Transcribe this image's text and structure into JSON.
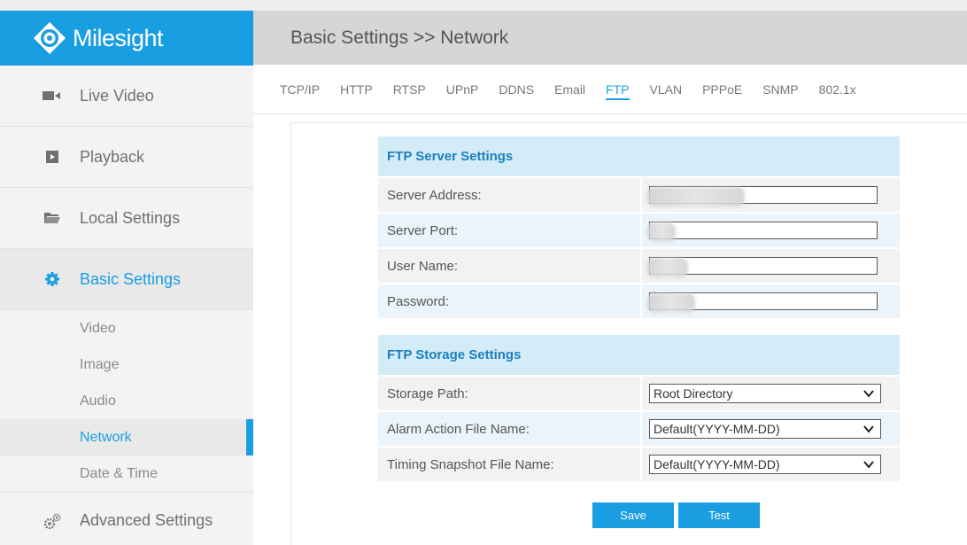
{
  "app": {
    "brand": "Milesight",
    "accent_color": "#1a9ee2"
  },
  "sidebar": {
    "items": [
      {
        "label": "Live Video",
        "icon": "video-camera-icon"
      },
      {
        "label": "Playback",
        "icon": "play-icon"
      },
      {
        "label": "Local Settings",
        "icon": "folder-icon"
      },
      {
        "label": "Basic Settings",
        "icon": "gear-icon"
      }
    ],
    "sub_items": [
      "Video",
      "Image",
      "Audio",
      "Network",
      "Date & Time"
    ],
    "active_sub": "Network",
    "bottom_item": {
      "label": "Advanced Settings",
      "icon": "gears-icon"
    }
  },
  "header": {
    "title": "Basic Settings >> Network"
  },
  "tabs": [
    "TCP/IP",
    "HTTP",
    "RTSP",
    "UPnP",
    "DDNS",
    "Email",
    "FTP",
    "VLAN",
    "PPPoE",
    "SNMP",
    "802.1x"
  ],
  "active_tab": "FTP",
  "ftp_server": {
    "title": "FTP Server Settings",
    "server_address_label": "Server Address:",
    "server_port_label": "Server Port:",
    "user_name_label": "User Name:",
    "password_label": "Password:"
  },
  "ftp_storage": {
    "title": "FTP Storage Settings",
    "storage_path_label": "Storage Path:",
    "storage_path_value": "Root Directory",
    "alarm_file_label": "Alarm Action File Name:",
    "alarm_file_value": "Default(YYYY-MM-DD)",
    "timing_file_label": "Timing Snapshot File Name:",
    "timing_file_value": "Default(YYYY-MM-DD)"
  },
  "actions": {
    "save_label": "Save",
    "test_label": "Test"
  }
}
